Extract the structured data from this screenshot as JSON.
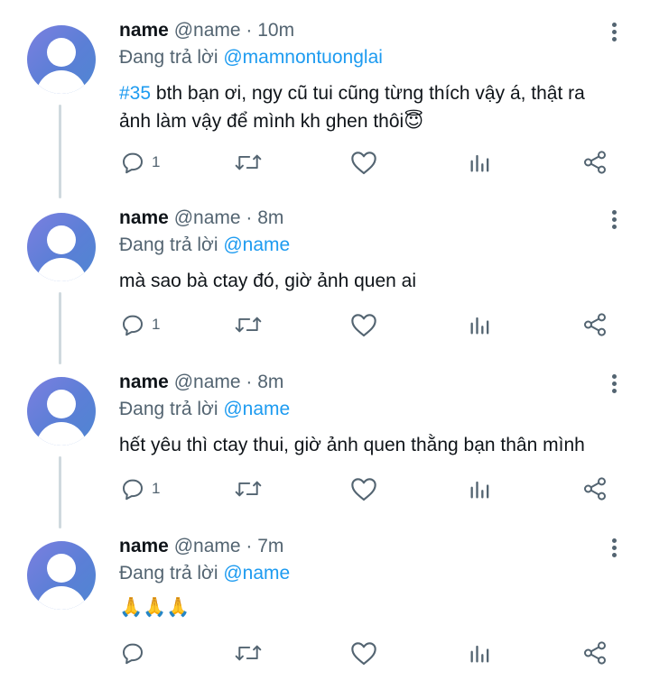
{
  "tweets": [
    {
      "display_name": "name",
      "handle": "@name",
      "time": "10m",
      "replying_prefix": "Đang trả lời",
      "replying_to": "@mamnontuonglai",
      "hashtag": "#35",
      "text_line1": "bth bạn ơi, ngy cũ tui cũng từng thích vậy á, thật ra",
      "text_line2": "ảnh làm vậy để mình kh ghen thôi😇",
      "reply_count": "1"
    },
    {
      "display_name": "name",
      "handle": "@name",
      "time": "8m",
      "replying_prefix": "Đang trả lời",
      "replying_to": "@name",
      "text_line1": "mà sao bà ctay đó, giờ ảnh quen ai",
      "reply_count": "1"
    },
    {
      "display_name": "name",
      "handle": "@name",
      "time": "8m",
      "replying_prefix": "Đang trả lời",
      "replying_to": "@name",
      "text_line1": "hết yêu thì ctay thui, giờ ảnh quen thằng bạn thân mình",
      "reply_count": "1"
    },
    {
      "display_name": "name",
      "handle": "@name",
      "time": "7m",
      "replying_prefix": "Đang trả lời",
      "replying_to": "@name",
      "text_line1": "🙏🙏🙏",
      "reply_count": ""
    }
  ],
  "icons": {
    "reply": "reply-icon",
    "retweet": "retweet-icon",
    "like": "heart-icon",
    "views": "analytics-icon",
    "share": "share-icon",
    "more": "more-vertical-icon",
    "avatar": "default-avatar"
  },
  "colors": {
    "link": "#1d9bf0",
    "secondary_text": "#536471",
    "primary_text": "#0f1419",
    "thread_line": "#cfd9de",
    "avatar": "#5b7fd6"
  }
}
